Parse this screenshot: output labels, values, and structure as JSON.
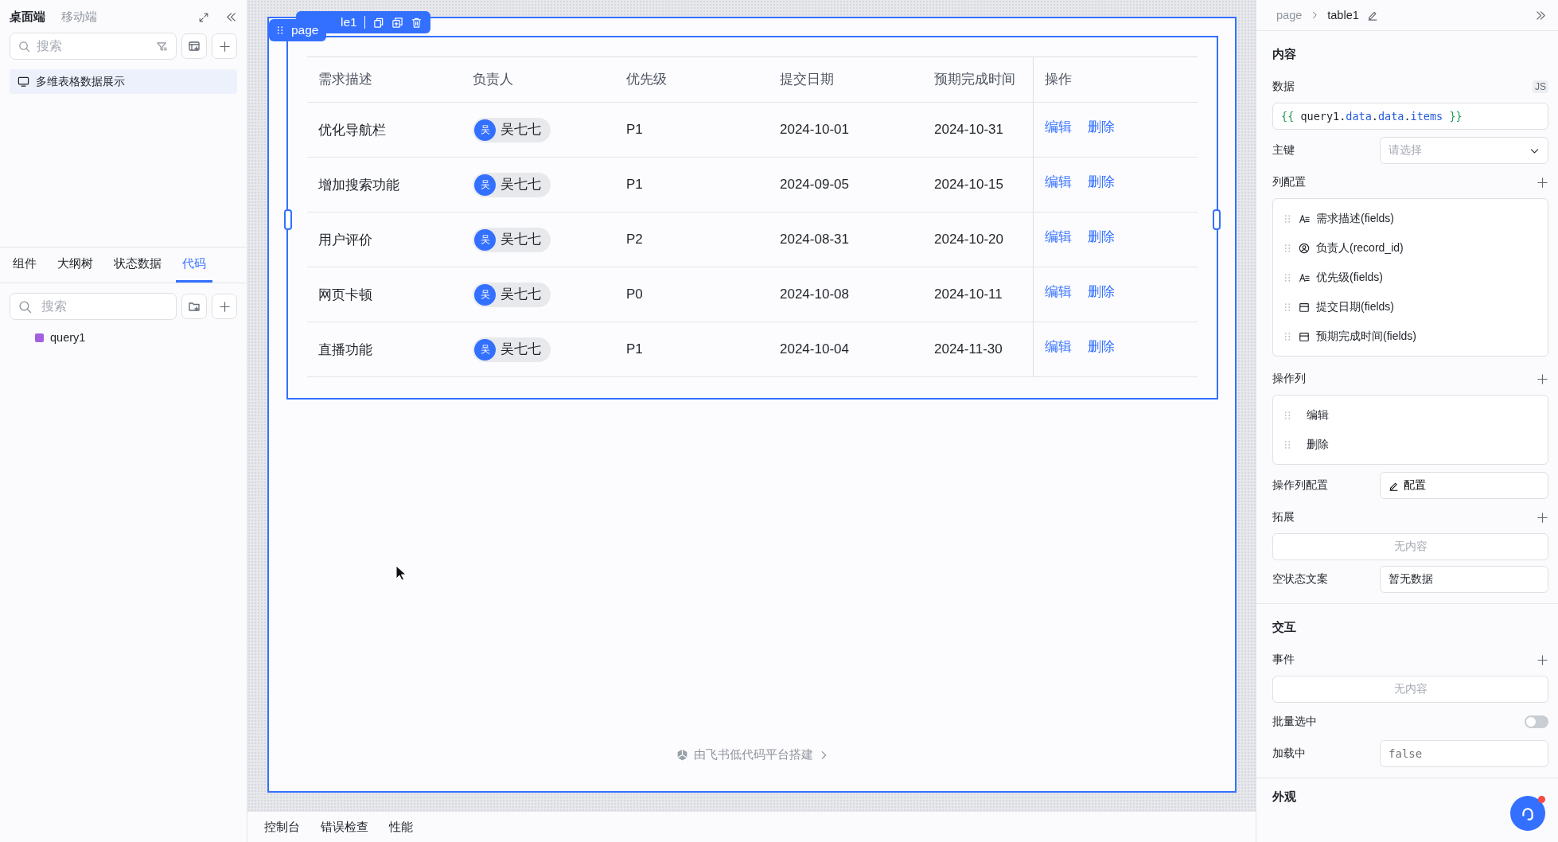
{
  "left_panel": {
    "platform_tabs": [
      {
        "label": "桌面端",
        "selected": true
      },
      {
        "label": "移动端",
        "selected": false
      }
    ],
    "search": {
      "placeholder": "搜索"
    },
    "pages": [
      {
        "label": "多维表格数据展示",
        "selected": true
      }
    ],
    "tabs": [
      {
        "label": "组件",
        "selected": false
      },
      {
        "label": "大纲树",
        "selected": false
      },
      {
        "label": "状态数据",
        "selected": false
      },
      {
        "label": "代码",
        "selected": true
      }
    ],
    "code_search": {
      "placeholder": "搜索"
    },
    "code_items": [
      {
        "label": "query1"
      }
    ]
  },
  "canvas": {
    "toolbar": {
      "label": "le1"
    },
    "page_tag": {
      "label": "page"
    },
    "table": {
      "columns": [
        "需求描述",
        "负责人",
        "优先级",
        "提交日期",
        "预期完成时间",
        "操作"
      ],
      "rows": [
        {
          "desc": "优化导航栏",
          "owner_initial": "吴",
          "owner": "吴七七",
          "priority": "P1",
          "submitted": "2024-10-01",
          "due": "2024-10-31",
          "actions": [
            "编辑",
            "删除"
          ]
        },
        {
          "desc": "增加搜索功能",
          "owner_initial": "吴",
          "owner": "吴七七",
          "priority": "P1",
          "submitted": "2024-09-05",
          "due": "2024-10-15",
          "actions": [
            "编辑",
            "删除"
          ]
        },
        {
          "desc": "用户评价",
          "owner_initial": "吴",
          "owner": "吴七七",
          "priority": "P2",
          "submitted": "2024-08-31",
          "due": "2024-10-20",
          "actions": [
            "编辑",
            "删除"
          ]
        },
        {
          "desc": "网页卡顿",
          "owner_initial": "吴",
          "owner": "吴七七",
          "priority": "P0",
          "submitted": "2024-10-08",
          "due": "2024-10-11",
          "actions": [
            "编辑",
            "删除"
          ]
        },
        {
          "desc": "直播功能",
          "owner_initial": "吴",
          "owner": "吴七七",
          "priority": "P1",
          "submitted": "2024-10-04",
          "due": "2024-11-30",
          "actions": [
            "编辑",
            "删除"
          ]
        }
      ]
    },
    "footer": "由飞书低代码平台搭建"
  },
  "bottom_tabs": [
    "控制台",
    "错误检查",
    "性能"
  ],
  "right_panel": {
    "breadcrumb": [
      "page",
      "table1"
    ],
    "content": {
      "title": "内容",
      "data_label": "数据",
      "js_badge": "JS",
      "data_expr": [
        {
          "text": "{{ ",
          "kind": "brace"
        },
        {
          "text": "query1.",
          "kind": "ident"
        },
        {
          "text": "data",
          "kind": "prop"
        },
        {
          "text": ".",
          "kind": "ident"
        },
        {
          "text": "data",
          "kind": "prop"
        },
        {
          "text": ".",
          "kind": "ident"
        },
        {
          "text": "items",
          "kind": "prop"
        },
        {
          "text": " }}",
          "kind": "brace"
        }
      ],
      "primary_key": {
        "label": "主键",
        "placeholder": "请选择"
      },
      "columns_config": {
        "label": "列配置",
        "items": [
          {
            "kind": "text",
            "label": "需求描述(fields)"
          },
          {
            "kind": "user",
            "label": "负责人(record_id)"
          },
          {
            "kind": "text",
            "label": "优先级(fields)"
          },
          {
            "kind": "date",
            "label": "提交日期(fields)"
          },
          {
            "kind": "date",
            "label": "预期完成时间(fields)"
          }
        ]
      },
      "action_columns": {
        "label": "操作列",
        "items": [
          "编辑",
          "删除"
        ]
      },
      "action_config": {
        "label": "操作列配置",
        "button": "配置"
      },
      "extension": {
        "label": "拓展",
        "empty": "无内容"
      },
      "empty_text": {
        "label": "空状态文案",
        "value": "暂无数据"
      }
    },
    "interaction": {
      "title": "交互",
      "events": {
        "label": "事件",
        "empty": "无内容"
      },
      "batch_select": {
        "label": "批量选中",
        "on": false
      },
      "loading": {
        "label": "加载中",
        "placeholder": "false"
      }
    },
    "appearance": {
      "title": "外观"
    }
  }
}
